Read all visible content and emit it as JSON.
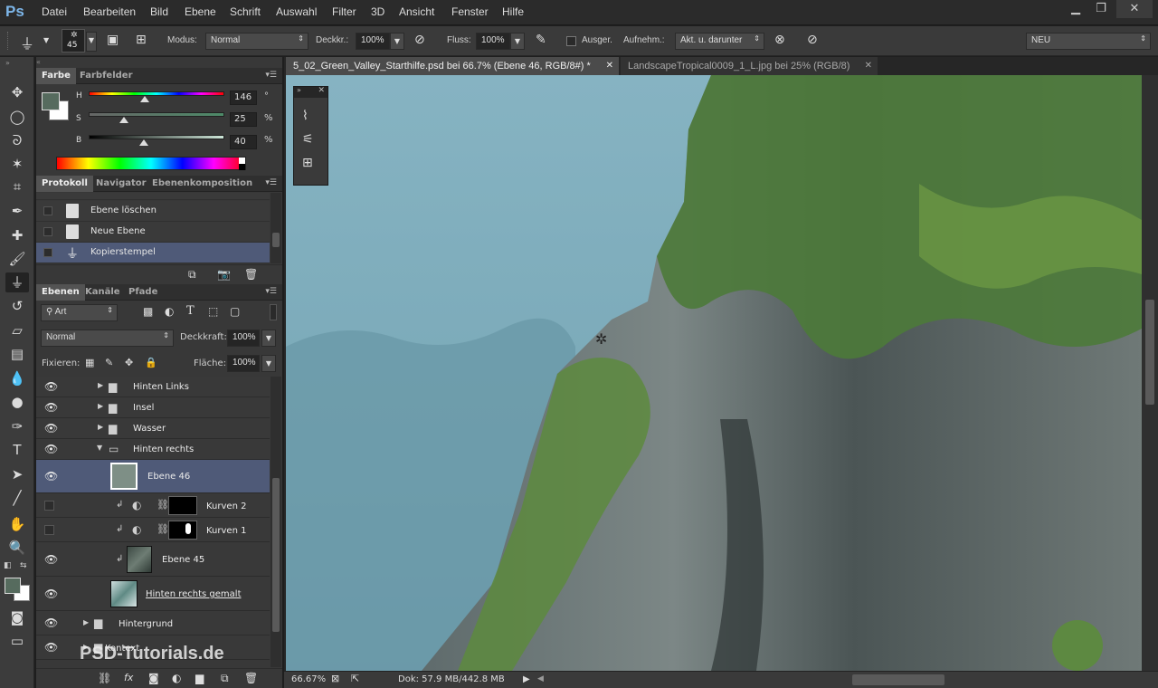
{
  "app": {
    "logo": "Ps"
  },
  "menu": [
    "Datei",
    "Bearbeiten",
    "Bild",
    "Ebene",
    "Schrift",
    "Auswahl",
    "Filter",
    "3D",
    "Ansicht",
    "Fenster",
    "Hilfe"
  ],
  "window_controls": {
    "minimize": "▁",
    "restore": "❐",
    "close": "✕"
  },
  "options": {
    "brush_size": "45",
    "mode_label": "Modus:",
    "mode_value": "Normal",
    "opacity_label": "Deckkr.:",
    "opacity_value": "100%",
    "flow_label": "Fluss:",
    "flow_value": "100%",
    "aligned_label": "Ausger.",
    "sample_label": "Aufnehm.:",
    "sample_value": "Akt. u. darunter",
    "workspace": "NEU"
  },
  "color_panel": {
    "tabs": [
      "Farbe",
      "Farbfelder"
    ],
    "h_label": "H",
    "s_label": "S",
    "b_label": "B",
    "h_value": "146",
    "s_value": "25",
    "b_value": "40",
    "h_unit": "°",
    "s_unit": "%",
    "b_unit": "%",
    "h_level": 0.405,
    "s_level": 0.25,
    "b_level": 0.4,
    "foreground": "#566b5e"
  },
  "history_panel": {
    "tabs": [
      "Protokoll",
      "Navigator",
      "Ebenenkomposition"
    ],
    "items": [
      {
        "label": "Ebene löschen"
      },
      {
        "label": "Neue Ebene"
      },
      {
        "label": "Kopierstempel"
      }
    ]
  },
  "layers_panel": {
    "tabs": [
      "Ebenen",
      "Kanäle",
      "Pfade"
    ],
    "filter_value": "Art",
    "blend_mode": "Normal",
    "opacity_label": "Deckkraft:",
    "opacity_value": "100%",
    "lock_label": "Fixieren:",
    "fill_label": "Fläche:",
    "fill_value": "100%",
    "layers": [
      {
        "name": "Hinten Links",
        "kind": "group"
      },
      {
        "name": "Insel",
        "kind": "group"
      },
      {
        "name": "Wasser",
        "kind": "group"
      },
      {
        "name": "Hinten rechts",
        "kind": "group-open"
      },
      {
        "name": "Ebene 46",
        "kind": "pixel"
      },
      {
        "name": "Kurven 2",
        "kind": "adjustment"
      },
      {
        "name": "Kurven 1",
        "kind": "adjustment"
      },
      {
        "name": "Ebene 45",
        "kind": "pixel"
      },
      {
        "name": "Hinten rechts gemalt",
        "kind": "pixel"
      },
      {
        "name": "Hintergrund",
        "kind": "group"
      },
      {
        "name": "Kontext",
        "kind": "group"
      }
    ]
  },
  "documents": {
    "tabs": [
      {
        "label": "5_02_Green_Valley_Starthilfe.psd bei 66.7% (Ebene 46, RGB/8#) *"
      },
      {
        "label": "LandscapeTropical0009_1_L.jpg bei 25% (RGB/8)"
      }
    ]
  },
  "status": {
    "zoom": "66.67%",
    "doc": "Dok: 57.9 MB/442.8 MB"
  },
  "watermark": "PSD-Tutorials.de"
}
